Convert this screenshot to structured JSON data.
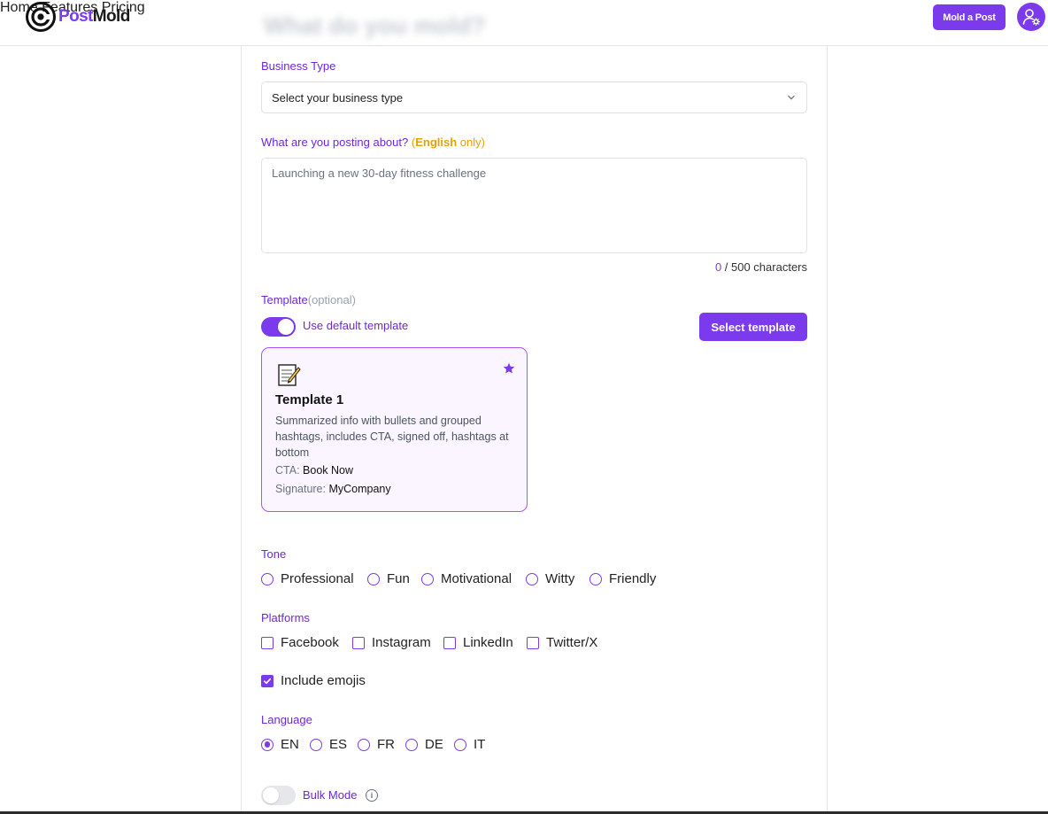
{
  "header": {
    "brand_post": "Post",
    "brand_mold": "Mold",
    "nav": [
      "Home",
      "Features",
      "Pricing"
    ],
    "cta_label": "Mold a Post",
    "page_title_blurred": "What do you mold?"
  },
  "form": {
    "business_type": {
      "label": "Business Type",
      "value": "Select your business type"
    },
    "topic": {
      "label": "What are you posting about?",
      "lang_note_open": "(",
      "lang_note_lang": "English",
      "lang_note_rest": " only)",
      "placeholder": "Launching a new 30-day fitness challenge",
      "char_count": "0",
      "char_limit_text": " / 500 characters"
    },
    "template": {
      "label": "Template",
      "optional": "(optional)",
      "toggle_label": "Use default template",
      "toggle_on": true,
      "select_button": "Select template",
      "card": {
        "icon": "memo-icon",
        "title": "Template 1",
        "description": "Summarized info with bullets and grouped hashtags, includes CTA, signed off, hashtags at bottom",
        "cta_label": "CTA:",
        "cta_value": "Book Now",
        "signature_label": "Signature:",
        "signature_value": "MyCompany"
      }
    },
    "tone": {
      "label": "Tone",
      "options": [
        "Professional",
        "Fun",
        "Motivational",
        "Witty",
        "Friendly"
      ],
      "selected": null
    },
    "platforms": {
      "label": "Platforms",
      "options": [
        "Facebook",
        "Instagram",
        "LinkedIn",
        "Twitter/X"
      ],
      "checked": []
    },
    "emojis": {
      "label": "Include emojis",
      "checked": true
    },
    "language": {
      "label": "Language",
      "options": [
        "EN",
        "ES",
        "FR",
        "DE",
        "IT"
      ],
      "selected": "EN"
    },
    "bulk_mode": {
      "label": "Bulk Mode",
      "on": false,
      "info_glyph": "i"
    }
  },
  "colors": {
    "accent": "#7c3aed",
    "label": "#6d28d9",
    "warning": "#e5a00d"
  }
}
